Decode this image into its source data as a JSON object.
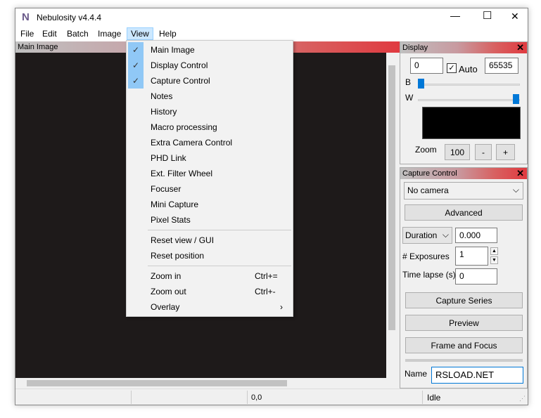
{
  "window": {
    "title": "Nebulosity v4.4.4",
    "minimize": "—",
    "maximize": "☐",
    "close": "✕"
  },
  "menubar": [
    "File",
    "Edit",
    "Batch",
    "Image",
    "View",
    "Help"
  ],
  "main_panel": {
    "title": "Main Image"
  },
  "view_menu": {
    "items": [
      {
        "label": "Main Image",
        "checked": true
      },
      {
        "label": "Display Control",
        "checked": true
      },
      {
        "label": "Capture Control",
        "checked": true
      },
      {
        "label": "Notes"
      },
      {
        "label": "History"
      },
      {
        "label": "Macro processing"
      },
      {
        "label": "Extra Camera Control"
      },
      {
        "label": "PHD Link"
      },
      {
        "label": "Ext. Filter Wheel"
      },
      {
        "label": "Focuser"
      },
      {
        "label": "Mini Capture"
      },
      {
        "label": "Pixel Stats"
      },
      {
        "label": "Reset view / GUI"
      },
      {
        "label": "Reset position"
      },
      {
        "label": "Zoom in",
        "shortcut": "Ctrl+="
      },
      {
        "label": "Zoom out",
        "shortcut": "Ctrl+-"
      },
      {
        "label": "Overlay",
        "submenu": "›"
      }
    ]
  },
  "display": {
    "title": "Display",
    "close": "✕",
    "black": "0",
    "auto_label": "Auto",
    "auto_checked": true,
    "white": "65535",
    "b_label": "B",
    "w_label": "W",
    "b_level": 0,
    "w_level": 1,
    "zoom_label": "Zoom",
    "zoom_value": "100",
    "zoom_minus": "-",
    "zoom_plus": "+"
  },
  "capture": {
    "title": "Capture Control",
    "close": "✕",
    "camera": "No camera",
    "advanced": "Advanced",
    "duration_mode": "Duration",
    "duration": "0.000",
    "exposures_label": "# Exposures",
    "exposures": "1",
    "timelapse_label": "Time lapse (s)",
    "timelapse": "0",
    "capture_series": "Capture Series",
    "preview": "Preview",
    "frame_focus": "Frame and Focus",
    "name_label": "Name",
    "name": "RSLOAD.NET"
  },
  "status": {
    "coords": "0,0",
    "state": "Idle"
  }
}
